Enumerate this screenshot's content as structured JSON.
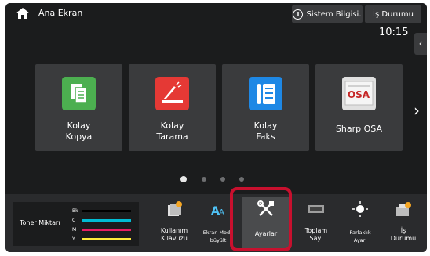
{
  "header": {
    "title": "Ana Ekran",
    "system_info_label": "Sistem Bilgisi.",
    "job_status_label": "İş Durumu",
    "clock": "10:15"
  },
  "tiles": [
    {
      "label_line1": "Kolay",
      "label_line2": "Kopya",
      "icon": "copy-icon",
      "color": "#4caf50"
    },
    {
      "label_line1": "Kolay",
      "label_line2": "Tarama",
      "icon": "scan-icon",
      "color": "#e53935"
    },
    {
      "label_line1": "Kolay",
      "label_line2": "Faks",
      "icon": "fax-icon",
      "color": "#1e88e5"
    },
    {
      "label_line1": "Sharp OSA",
      "label_line2": "",
      "icon": "sharp-osa-icon",
      "color": "#e0e0e0"
    }
  ],
  "toner": {
    "title": "Toner Miktarı",
    "levels": [
      {
        "label": "Bk",
        "color": "#000000"
      },
      {
        "label": "C",
        "color": "#00bcd4"
      },
      {
        "label": "M",
        "color": "#e91e63"
      },
      {
        "label": "Y",
        "color": "#ffeb3b"
      }
    ]
  },
  "bottom_items": [
    {
      "label_line1": "Kullanım",
      "label_line2": "Kılavuzu",
      "icon": "manual-icon"
    },
    {
      "label_line1": "Ekran Modu",
      "label_line2": "büyült",
      "icon": "display-mode-icon"
    },
    {
      "label_line1": "Ayarlar",
      "label_line2": "",
      "icon": "settings-icon"
    },
    {
      "label_line1": "Toplam",
      "label_line2": "Sayı",
      "icon": "counter-icon"
    },
    {
      "label_line1": "Parlaklık",
      "label_line2": "Ayarı",
      "icon": "brightness-icon"
    },
    {
      "label_line1": "İş",
      "label_line2": "Durumu",
      "icon": "job-status-icon"
    }
  ],
  "osa_logo_text": "OSA"
}
